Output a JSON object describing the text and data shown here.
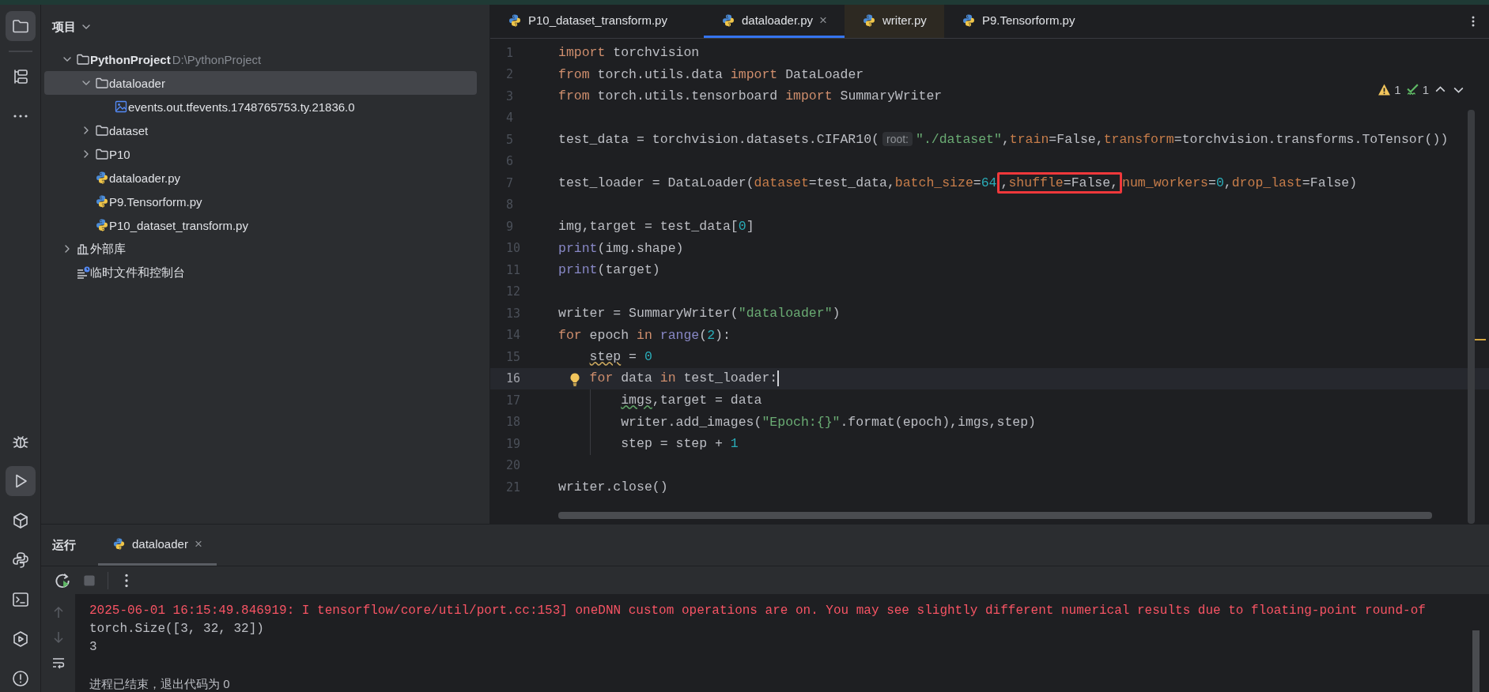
{
  "toolbar": {
    "top": [
      {
        "kind": "project",
        "selected": true
      },
      {
        "kind": "structure",
        "selected": false
      },
      {
        "kind": "more",
        "selected": false
      }
    ],
    "bottom": [
      {
        "kind": "debug",
        "selected": false
      },
      {
        "kind": "run",
        "selected": true
      },
      {
        "kind": "packages",
        "selected": false
      },
      {
        "kind": "python-console",
        "selected": false
      },
      {
        "kind": "terminal",
        "selected": false
      },
      {
        "kind": "services",
        "selected": false
      },
      {
        "kind": "problems",
        "selected": false
      }
    ]
  },
  "project": {
    "title": "项目",
    "tree": [
      {
        "kind": "folder",
        "name": "PythonProject",
        "path": "D:\\PythonProject",
        "expanded": true,
        "selected": false,
        "children": [
          {
            "kind": "folder",
            "name": "dataloader",
            "expanded": true,
            "selected": true,
            "children": [
              {
                "kind": "image-file",
                "name": "events.out.tfevents.1748765753.ty.21836.0",
                "selected": false
              }
            ]
          },
          {
            "kind": "folder",
            "name": "dataset",
            "expanded": false,
            "selected": false
          },
          {
            "kind": "folder",
            "name": "P10",
            "expanded": false,
            "selected": false
          },
          {
            "kind": "python",
            "name": "dataloader.py",
            "selected": false
          },
          {
            "kind": "python",
            "name": "P9.Tensorform.py",
            "selected": false
          },
          {
            "kind": "python",
            "name": "P10_dataset_transform.py",
            "selected": false
          }
        ]
      },
      {
        "kind": "library",
        "name": "外部库",
        "expanded": false,
        "selected": false
      },
      {
        "kind": "scratch",
        "name": "临时文件和控制台",
        "selected": false
      }
    ]
  },
  "editor": {
    "tabs": [
      {
        "label": "P10_dataset_transform.py",
        "selected": false,
        "tinted": false
      },
      {
        "label": "dataloader.py",
        "selected": true,
        "tinted": false,
        "close": "×"
      },
      {
        "label": "writer.py",
        "selected": false,
        "tinted": true
      },
      {
        "label": "P9.Tensorform.py",
        "selected": false,
        "tinted": false
      }
    ],
    "inspections": {
      "warnings": "1",
      "weak_warnings": "1"
    },
    "lines": [
      {
        "number": "1",
        "current": false,
        "tokens": [
          {
            "kind": "kw",
            "text": "import"
          },
          {
            "kind": "p",
            "text": " torchvision"
          }
        ]
      },
      {
        "number": "2",
        "current": false,
        "tokens": [
          {
            "kind": "kw",
            "text": "from"
          },
          {
            "kind": "p",
            "text": " torch.utils.data "
          },
          {
            "kind": "kw",
            "text": "import"
          },
          {
            "kind": "p",
            "text": " DataLoader"
          }
        ]
      },
      {
        "number": "3",
        "current": false,
        "tokens": [
          {
            "kind": "kw",
            "text": "from"
          },
          {
            "kind": "p",
            "text": " torch.utils.tensorboard "
          },
          {
            "kind": "kw",
            "text": "import"
          },
          {
            "kind": "p",
            "text": " SummaryWriter"
          }
        ]
      },
      {
        "number": "4",
        "current": false
      },
      {
        "number": "5",
        "current": false,
        "tokens": [
          {
            "kind": "p",
            "text": "test_data = torchvision.datasets.CIFAR10("
          },
          {
            "kind": "hint",
            "text": "root:"
          },
          {
            "kind": "str",
            "text": "\"./dataset\""
          },
          {
            "kind": "p",
            "text": ","
          },
          {
            "kind": "param",
            "text": "train"
          },
          {
            "kind": "p",
            "text": "=False,"
          },
          {
            "kind": "param",
            "text": "transform"
          },
          {
            "kind": "p",
            "text": "=torchvision.transforms.ToTensor())"
          }
        ]
      },
      {
        "number": "6",
        "current": false
      },
      {
        "number": "7",
        "current": false,
        "tokens": [
          {
            "kind": "p",
            "text": "test_loader = DataLoader("
          },
          {
            "kind": "param",
            "text": "dataset"
          },
          {
            "kind": "p",
            "text": "=test_data,"
          },
          {
            "kind": "param",
            "text": "batch_size"
          },
          {
            "kind": "p",
            "text": "="
          },
          {
            "kind": "num",
            "text": "64"
          },
          {
            "kind": "p",
            "text": ",",
            "boxed": true
          },
          {
            "kind": "param",
            "text": "shuffle",
            "boxed": true
          },
          {
            "kind": "p",
            "text": "=False,",
            "boxed": true
          },
          {
            "kind": "param",
            "text": "num_workers"
          },
          {
            "kind": "p",
            "text": "="
          },
          {
            "kind": "num",
            "text": "0"
          },
          {
            "kind": "p",
            "text": ","
          },
          {
            "kind": "param",
            "text": "drop_last"
          },
          {
            "kind": "p",
            "text": "=False)"
          }
        ]
      },
      {
        "number": "8",
        "current": false
      },
      {
        "number": "9",
        "current": false,
        "tokens": [
          {
            "kind": "p",
            "text": "img,target = test_data["
          },
          {
            "kind": "num",
            "text": "0"
          },
          {
            "kind": "p",
            "text": "]"
          }
        ]
      },
      {
        "number": "10",
        "current": false,
        "tokens": [
          {
            "kind": "builtin",
            "text": "print"
          },
          {
            "kind": "p",
            "text": "(img.shape)"
          }
        ]
      },
      {
        "number": "11",
        "current": false,
        "tokens": [
          {
            "kind": "builtin",
            "text": "print"
          },
          {
            "kind": "p",
            "text": "(target)"
          }
        ]
      },
      {
        "number": "12",
        "current": false
      },
      {
        "number": "13",
        "current": false,
        "tokens": [
          {
            "kind": "p",
            "text": "writer = SummaryWriter("
          },
          {
            "kind": "str",
            "text": "\"dataloader\""
          },
          {
            "kind": "p",
            "text": ")"
          }
        ]
      },
      {
        "number": "14",
        "current": false,
        "tokens": [
          {
            "kind": "kw",
            "text": "for"
          },
          {
            "kind": "p",
            "text": " epoch "
          },
          {
            "kind": "kw",
            "text": "in"
          },
          {
            "kind": "builtin",
            "text": " range"
          },
          {
            "kind": "p",
            "text": "("
          },
          {
            "kind": "num",
            "text": "2"
          },
          {
            "kind": "p",
            "text": "):"
          }
        ],
        "children": [
          {
            "number": "15",
            "current": false,
            "tokens": [
              {
                "kind": "warn",
                "text": "step"
              },
              {
                "kind": "p",
                "text": " = "
              },
              {
                "kind": "num",
                "text": "0"
              }
            ]
          },
          {
            "number": "16",
            "current": true,
            "tokens": [
              {
                "kind": "kw",
                "text": "for"
              },
              {
                "kind": "p",
                "text": " data "
              },
              {
                "kind": "kw",
                "text": "in"
              },
              {
                "kind": "p",
                "text": " test_loader:"
              }
            ],
            "children": [
              {
                "number": "17",
                "current": false,
                "tokens": [
                  {
                    "kind": "weak",
                    "text": "imgs"
                  },
                  {
                    "kind": "p",
                    "text": ",target = data"
                  }
                ]
              },
              {
                "number": "18",
                "current": false,
                "tokens": [
                  {
                    "kind": "p",
                    "text": "writer.add_images("
                  },
                  {
                    "kind": "str",
                    "text": "\"Epoch:{}\""
                  },
                  {
                    "kind": "p",
                    "text": ".format(epoch),imgs,step)"
                  }
                ]
              },
              {
                "number": "19",
                "current": false,
                "tokens": [
                  {
                    "kind": "p",
                    "text": "step = step + "
                  },
                  {
                    "kind": "num",
                    "text": "1"
                  }
                ]
              }
            ]
          }
        ]
      },
      {
        "number": "20",
        "current": false
      },
      {
        "number": "21",
        "current": false,
        "tokens": [
          {
            "kind": "p",
            "text": "writer.close()"
          }
        ]
      }
    ]
  },
  "run_panel": {
    "title": "运行",
    "tabs": [
      {
        "label": "dataloader",
        "selected": true,
        "close": "×"
      }
    ],
    "console": [
      {
        "kind": "error",
        "text": "2025-06-01 16:15:49.846919: I tensorflow/core/util/port.cc:153] oneDNN custom operations are on. You may see slightly different numerical results due to floating-point round-of"
      },
      {
        "kind": "output",
        "text": "torch.Size([3, 32, 32])"
      },
      {
        "kind": "output",
        "text": "3"
      },
      {
        "kind": "blank"
      },
      {
        "kind": "system",
        "text": "进程已结束，退出代码为 0"
      }
    ]
  }
}
